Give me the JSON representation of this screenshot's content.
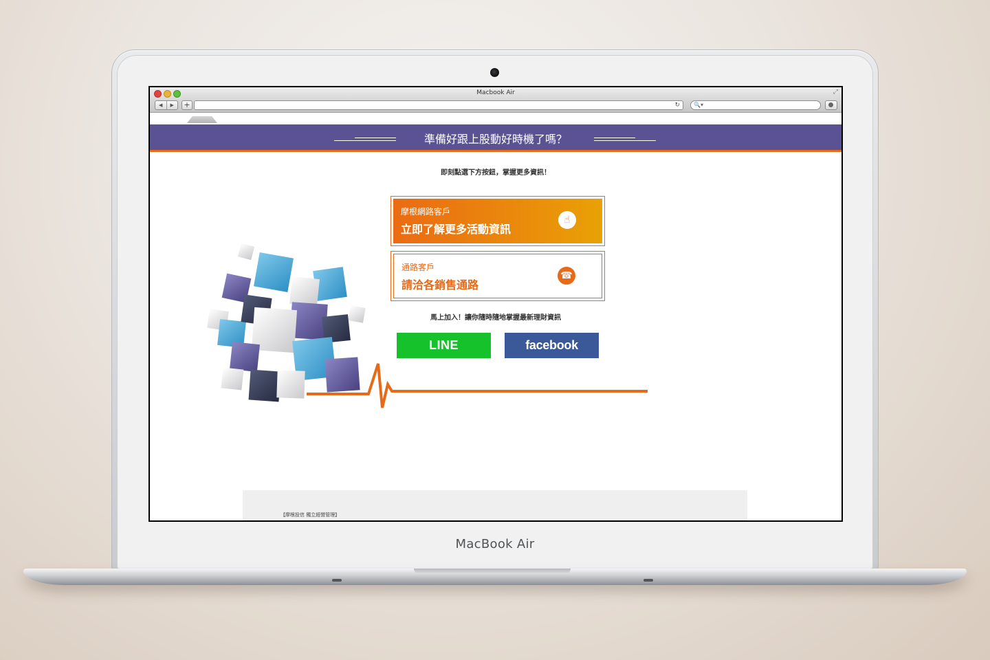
{
  "device": {
    "brand_label": "MacBook Air"
  },
  "browser": {
    "window_title": "Macbook Air",
    "back_icon": "◀",
    "forward_icon": "▶",
    "add_tab_label": "+",
    "reload_icon": "↻",
    "search_icon": "🔍▾"
  },
  "page": {
    "banner_title": "準備好跟上股動好時機了嗎？",
    "subtitle": "即刻點選下方按鈕，掌握更多資訊！",
    "cards": [
      {
        "small": "摩根網路客戶",
        "big": "立即了解更多活動資訊",
        "icon": "pointer-hand-icon",
        "icon_glyph": "☝"
      },
      {
        "small": "通路客戶",
        "big": "請洽各銷售通路",
        "icon": "telephone-icon",
        "icon_glyph": "☎"
      }
    ],
    "join_text": "馬上加入！讓你隨時隨地掌握最新理財資訊",
    "line_label": "LINE",
    "facebook_label": "facebook",
    "footer_text": "【摩根投信 獨立經營管理】"
  },
  "colors": {
    "banner": "#5b5294",
    "accent_orange": "#e66a17",
    "line_green": "#15c22b",
    "facebook_blue": "#3b5998"
  }
}
